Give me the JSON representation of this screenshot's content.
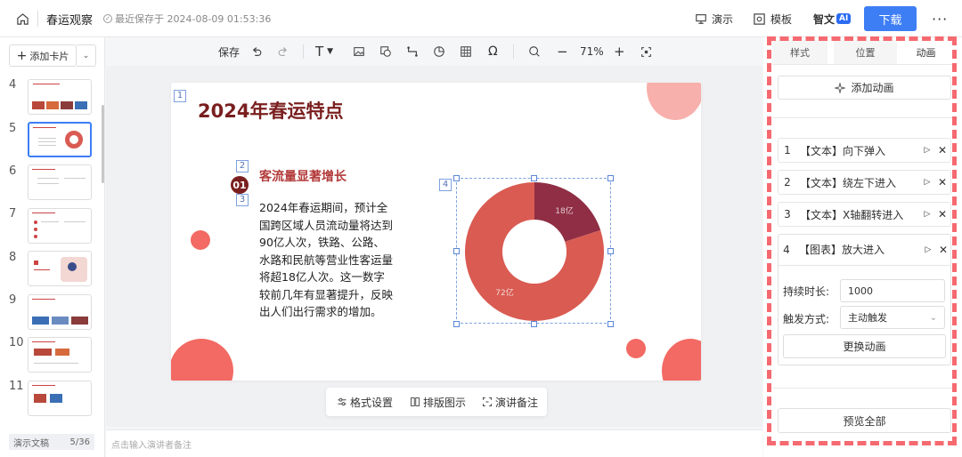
{
  "header": {
    "title": "春运观察",
    "save_status": "最近保存于 2024-08-09 01:53:36",
    "present_label": "演示",
    "template_label": "模板",
    "ai_label": "智文",
    "ai_badge": "AI",
    "download_label": "下载",
    "more_icon": "ellipsis-icon"
  },
  "left_panel": {
    "add_card_label": "添加卡片",
    "thumbnails": [
      {
        "num": "4"
      },
      {
        "num": "5"
      },
      {
        "num": "6"
      },
      {
        "num": "7"
      },
      {
        "num": "8"
      },
      {
        "num": "9"
      },
      {
        "num": "10"
      },
      {
        "num": "11"
      }
    ],
    "active_thumbnail": "5",
    "footer_label": "演示文稿",
    "page_counter": "5/36"
  },
  "toolbar": {
    "save_label": "保存",
    "zoom_value": "71%"
  },
  "slide": {
    "title": "2024年春运特点",
    "markers": [
      "1",
      "2",
      "3",
      "4"
    ],
    "badge": "01",
    "subtitle": "客流量显著增长",
    "body": "2024年春运期间，预计全国跨区域人员流动量将达到90亿人次，铁路、公路、水路和民航等营业性客运量将超18亿人次。这一数字较前几年有显著提升，反映出人们出行需求的增加。"
  },
  "chart_data": {
    "type": "pie",
    "donut": true,
    "categories": [
      "",
      ""
    ],
    "values": [
      18,
      72
    ],
    "data_labels": [
      "18亿",
      "72亿"
    ],
    "colors": [
      "#8f2e44",
      "#d95b52"
    ]
  },
  "float_toolbar": {
    "format_label": "格式设置",
    "layout_label": "排版图示",
    "notes_label": "演讲备注"
  },
  "notes_placeholder": "点击输入演讲者备注",
  "right_panel": {
    "tabs": [
      "样式",
      "位置",
      "动画"
    ],
    "active_tab": "动画",
    "add_animation_label": "添加动画",
    "animations": [
      {
        "num": "1",
        "label": "【文本】向下弹入"
      },
      {
        "num": "2",
        "label": "【文本】绕左下进入"
      },
      {
        "num": "3",
        "label": "【文本】X轴翻转进入"
      },
      {
        "num": "4",
        "label": "【图表】放大进入"
      }
    ],
    "duration_label": "持续时长:",
    "duration_value": "1000",
    "trigger_label": "触发方式:",
    "trigger_value": "主动触发",
    "change_animation_label": "更换动画",
    "preview_all_label": "预览全部",
    "highlight_color": "#f56a70"
  }
}
